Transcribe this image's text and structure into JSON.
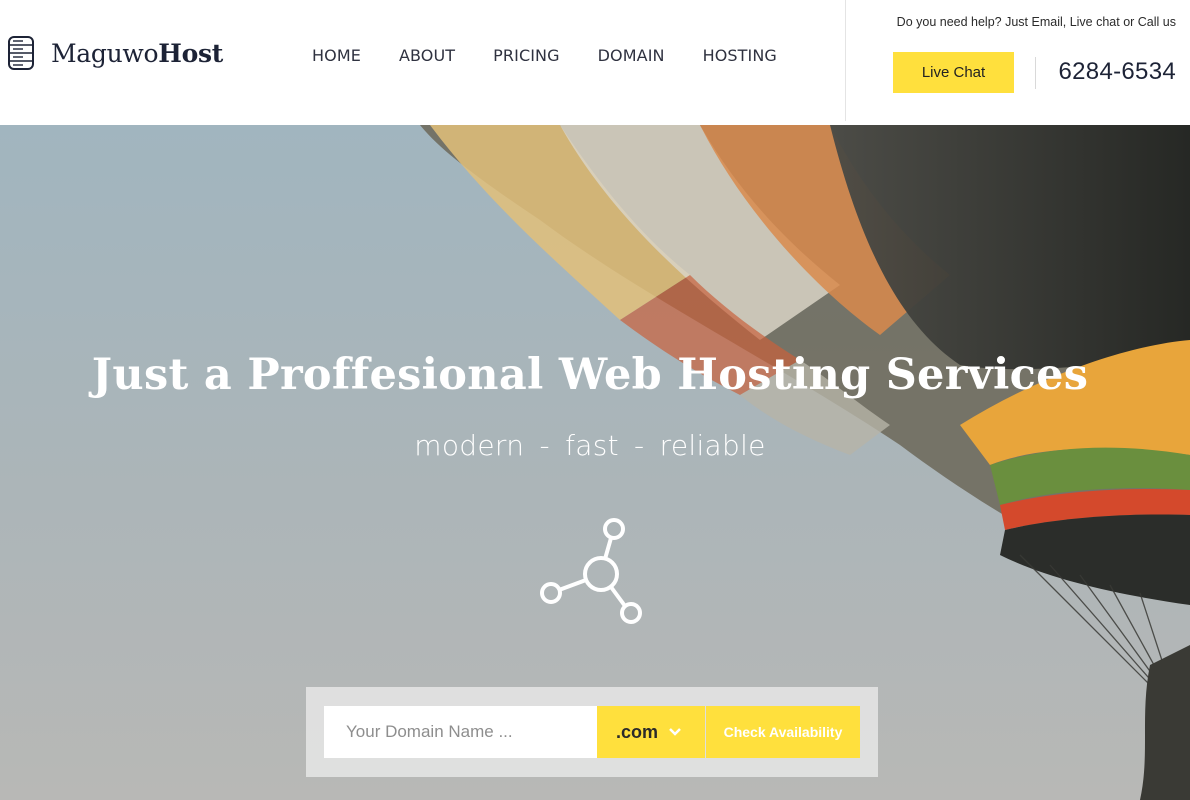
{
  "brand": {
    "name_light": "Maguwo",
    "name_bold": "Host"
  },
  "nav": [
    "HOME",
    "ABOUT",
    "PRICING",
    "DOMAIN",
    "HOSTING"
  ],
  "contact": {
    "help_text": "Do you need help? Just Email, Live chat or Call us",
    "live_chat_label": "Live Chat",
    "phone": "6284-6534"
  },
  "hero": {
    "title": "Just a Proffesional Web Hosting Services",
    "subtitle": "modern  -  fast  -  reliable",
    "icon": "share-network-icon"
  },
  "domain_search": {
    "placeholder": "Your Domain Name ...",
    "value": "",
    "tld_selected": ".com",
    "check_label": "Check Availability"
  },
  "colors": {
    "accent": "#ffe03d",
    "brand_dark": "#1d2336"
  }
}
